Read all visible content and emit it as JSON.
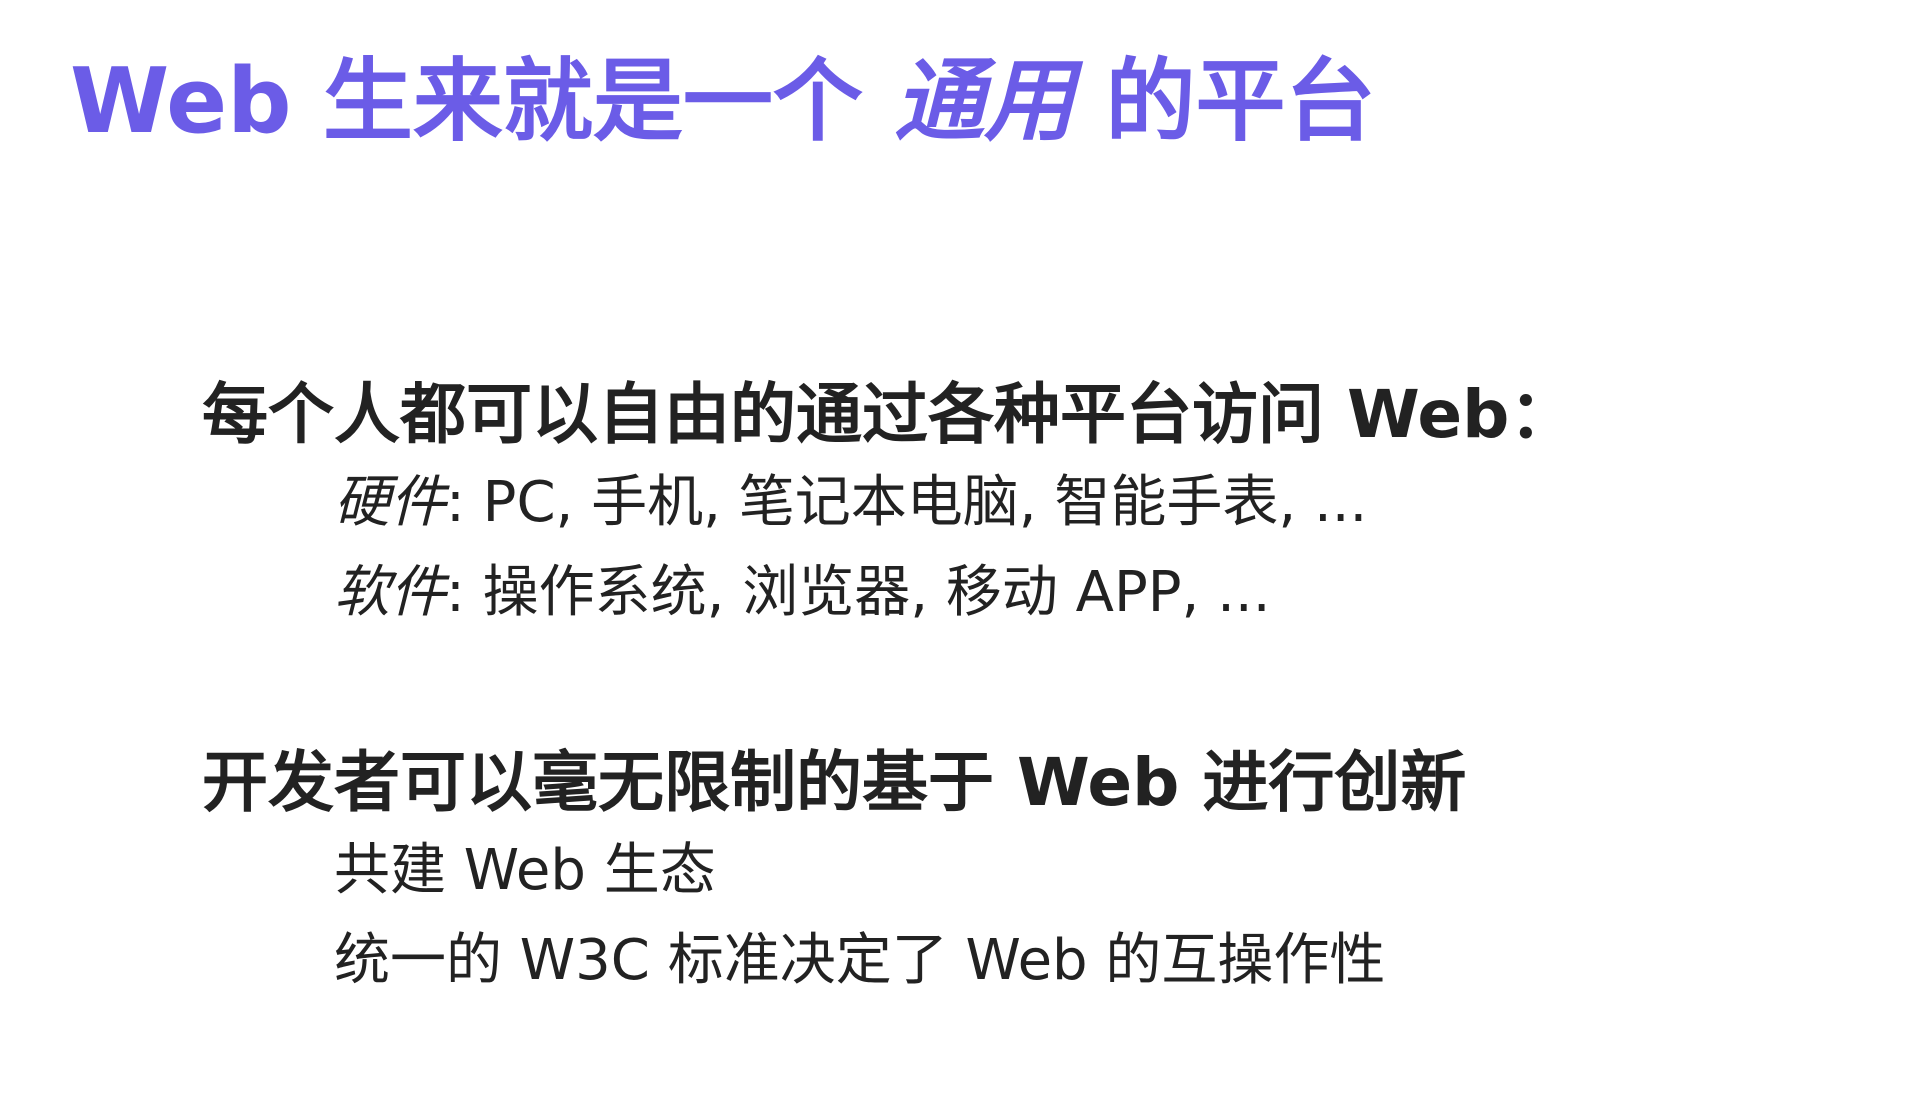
{
  "colors": {
    "title": "#6b5ce7",
    "text": "#222222",
    "background": "#ffffff"
  },
  "title": {
    "prefix": "Web 生来就是一个 ",
    "emphasis": "通用",
    "suffix": " 的平台"
  },
  "sections": [
    {
      "heading": "每个人都可以自由的通过各种平台访问 Web：",
      "items": [
        {
          "label": "硬件",
          "text": ": PC, 手机, 笔记本电脑, 智能手表, ..."
        },
        {
          "label": "软件",
          "text": ": 操作系统, 浏览器, 移动 APP, ..."
        }
      ]
    },
    {
      "heading": "开发者可以毫无限制的基于 Web 进行创新",
      "items": [
        {
          "text": "共建 Web 生态"
        },
        {
          "text": "统一的 W3C 标准决定了 Web 的互操作性"
        }
      ]
    }
  ]
}
